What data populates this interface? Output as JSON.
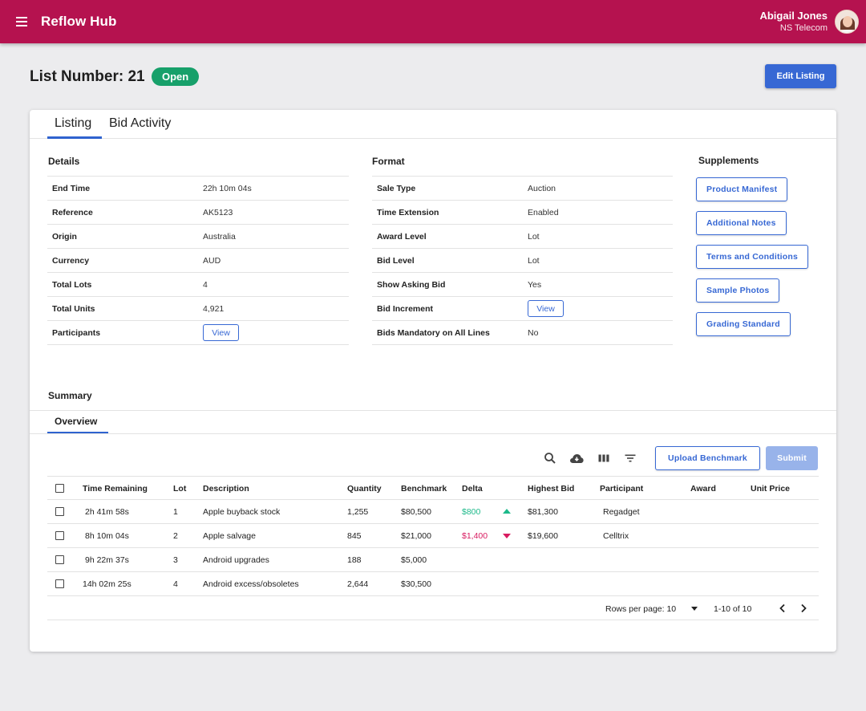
{
  "app": {
    "title": "Reflow Hub",
    "user_name": "Abigail Jones",
    "user_org": "NS Telecom"
  },
  "page": {
    "title": "List Number: 21",
    "status": "Open",
    "edit_button": "Edit Listing"
  },
  "tabs": [
    "Listing",
    "Bid Activity"
  ],
  "details": {
    "title": "Details",
    "rows": [
      {
        "key": "End Time",
        "value": "22h 10m 04s"
      },
      {
        "key": "Reference",
        "value": "AK5123"
      },
      {
        "key": "Origin",
        "value": "Australia"
      },
      {
        "key": "Currency",
        "value": "AUD"
      },
      {
        "key": "Total Lots",
        "value": "4"
      },
      {
        "key": "Total Units",
        "value": "4,921"
      },
      {
        "key": "Participants",
        "value": "View"
      }
    ]
  },
  "format": {
    "title": "Format",
    "rows": [
      {
        "key": "Sale Type",
        "value": "Auction"
      },
      {
        "key": "Time Extension",
        "value": "Enabled"
      },
      {
        "key": "Award Level",
        "value": "Lot"
      },
      {
        "key": "Bid Level",
        "value": "Lot"
      },
      {
        "key": "Show Asking Bid",
        "value": "Yes"
      },
      {
        "key": "Bid Increment",
        "value": "View"
      },
      {
        "key": "Bids Mandatory on All Lines",
        "value": "No"
      }
    ]
  },
  "supplements": {
    "title": "Supplements",
    "buttons": [
      "Product Manifest",
      "Additional Notes",
      "Terms and Conditions",
      "Sample Photos",
      "Grading Standard"
    ]
  },
  "summary": {
    "title": "Summary",
    "tab": "Overview",
    "upload_button": "Upload Benchmark",
    "submit_button": "Submit",
    "icons": [
      "search-icon",
      "cloud-download-icon",
      "columns-icon",
      "filter-icon"
    ],
    "columns": [
      "Time Remaining",
      "Lot",
      "Description",
      "Quantity",
      "Benchmark",
      "Delta",
      "Highest Bid",
      "Participant",
      "Award",
      "Unit Price"
    ],
    "rows": [
      {
        "time": "2h 41m 58s",
        "lot": "1",
        "description": "Apple buyback stock",
        "quantity": "1,255",
        "benchmark": "$80,500",
        "delta": "$800",
        "trend": "up",
        "highest_bid": "$81,300",
        "participant": "Regadget",
        "award": "",
        "unit_price": ""
      },
      {
        "time": "8h 10m 04s",
        "lot": "2",
        "description": "Apple salvage",
        "quantity": "845",
        "benchmark": "$21,000",
        "delta": "$1,400",
        "trend": "down",
        "highest_bid": "$19,600",
        "participant": "Celltrix",
        "award": "",
        "unit_price": ""
      },
      {
        "time": "9h 22m 37s",
        "lot": "3",
        "description": "Android upgrades",
        "quantity": "188",
        "benchmark": "$5,000",
        "delta": "",
        "trend": "",
        "highest_bid": "",
        "participant": "",
        "award": "",
        "unit_price": ""
      },
      {
        "time": "14h 02m 25s",
        "lot": "4",
        "description": "Android excess/obsoletes",
        "quantity": "2,644",
        "benchmark": "$30,500",
        "delta": "",
        "trend": "",
        "highest_bid": "",
        "participant": "",
        "award": "",
        "unit_price": ""
      }
    ],
    "pagination": {
      "rows_per_page_label": "Rows per page: 10",
      "range": "1-10 of 10"
    }
  },
  "colors": {
    "brand": "#b5124f",
    "primary": "#3768d4",
    "status_open": "#17a06a",
    "delta_up": "#1db98a",
    "delta_down": "#d81b60"
  }
}
